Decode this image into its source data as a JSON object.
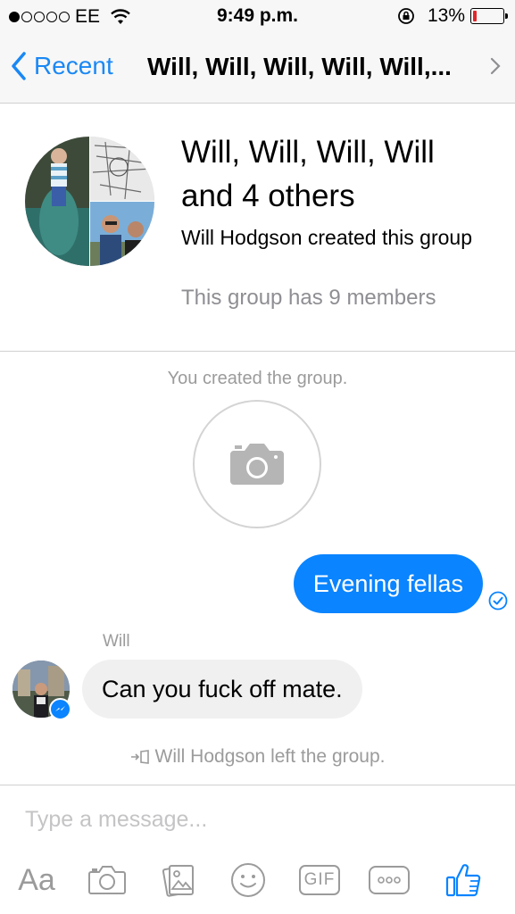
{
  "status_bar": {
    "carrier": "EE",
    "time": "9:49 p.m.",
    "battery": "13%",
    "battery_level": 0.13,
    "signal_bars_filled": 1,
    "signal_bars_total": 5
  },
  "nav": {
    "back_label": "Recent",
    "title": "Will, Will, Will, Will, Will,..."
  },
  "group_header": {
    "name": "Will, Will, Will, Will and 4 others",
    "created_by": "Will Hodgson created this group",
    "members": "This group has 9 members"
  },
  "thread": {
    "created_notice": "You created the group.",
    "outgoing_message": "Evening fellas",
    "incoming_sender": "Will",
    "incoming_message": "Can you fuck off mate.",
    "left_notice": "Will Hodgson left the group."
  },
  "composer": {
    "placeholder": "Type a message...",
    "aa_label": "Aa",
    "gif_label": "GIF",
    "icons": [
      "camera-icon",
      "gallery-icon",
      "emoji-icon",
      "gif-icon",
      "more-icon",
      "thumbs-up-icon"
    ]
  },
  "colors": {
    "accent": "#0a84ff",
    "incoming_bubble": "#f0f0f0",
    "muted_text": "#9b9b9b",
    "battery_low": "#e0262b"
  }
}
